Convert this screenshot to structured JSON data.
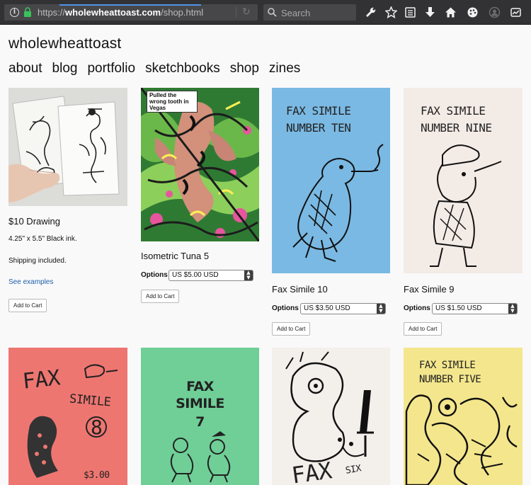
{
  "browser": {
    "url_prefix": "https://",
    "url_domain": "wholewheattoast.com",
    "url_path": "/shop.html",
    "search_placeholder": "Search"
  },
  "site": {
    "title": "wholewheattoast",
    "nav": [
      "about",
      "blog",
      "portfolio",
      "sketchbooks",
      "shop",
      "zines"
    ]
  },
  "products": [
    {
      "title": "$10 Drawing",
      "desc_1": "4.25\" x 5.5\" Black ink.",
      "desc_2": "Shipping included.",
      "link": "See examples",
      "cart": "Add to Cart"
    },
    {
      "caption": "Pulled the wrong tooth in Vegas",
      "title": "Isometric Tuna 5",
      "options_label": "Options",
      "price": "US $5.00 USD",
      "cart": "Add to Cart"
    },
    {
      "cover_line_1": "FAX SIMILE",
      "cover_line_2": "NUMBER TEN",
      "title": "Fax Simile 10",
      "options_label": "Options",
      "price": "US $3.50 USD",
      "cart": "Add to Cart"
    },
    {
      "cover_line_1": "FAX SIMILE",
      "cover_line_2": "NUMBER  NINE",
      "title": "Fax Simile 9",
      "options_label": "Options",
      "price": "US $1.50 USD",
      "cart": "Add to Cart"
    },
    {
      "cover_line_1": "FAX",
      "cover_line_2": "SIMILE",
      "cover_line_3": "8",
      "cover_line_4": "$3.00"
    },
    {
      "cover_line_1": "FAX",
      "cover_line_2": "SIMILE",
      "cover_line_3": "7"
    },
    {
      "cover_line_1": "FAX",
      "cover_line_2": "SIX"
    },
    {
      "cover_line_1": "FAX SIMILE",
      "cover_line_2": "NUMBER FIVE"
    }
  ],
  "colors": {
    "toolbar": "#323234",
    "cover_blue": "#7ab9e3",
    "cover_pink": "#f3ebe6",
    "cover_red": "#ee7671",
    "cover_green": "#6fcf97",
    "cover_white": "#f3efeb",
    "cover_yellow": "#f4e68c"
  }
}
